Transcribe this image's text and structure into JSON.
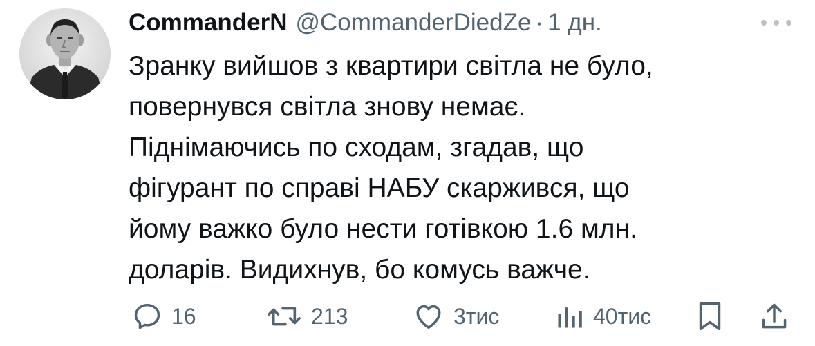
{
  "tweet": {
    "display_name": "CommanderN",
    "handle": "@CommanderDiedZe",
    "separator": "·",
    "time": "1 дн.",
    "text_lines": [
      "Зранку вийшов з квартири світла не було,",
      "повернувся світла знову немає.",
      "Піднімаючись по сходам, згадав, що",
      "фігурант по справі НАБУ скаржився, що",
      "йому важко було нести готівкою 1.6 млн.",
      "доларів. Видихнув, бо комусь важче."
    ]
  },
  "actions": {
    "reply": {
      "icon": "reply-icon",
      "count": "16"
    },
    "retweet": {
      "icon": "retweet-icon",
      "count": "213"
    },
    "like": {
      "icon": "heart-icon",
      "count": "3тис"
    },
    "views": {
      "icon": "analytics-icon",
      "count": "40тис"
    },
    "bookmark": {
      "icon": "bookmark-icon"
    },
    "share": {
      "icon": "share-icon"
    }
  },
  "colors": {
    "text": "#0f1419",
    "secondary": "#536471",
    "background": "#ffffff"
  }
}
